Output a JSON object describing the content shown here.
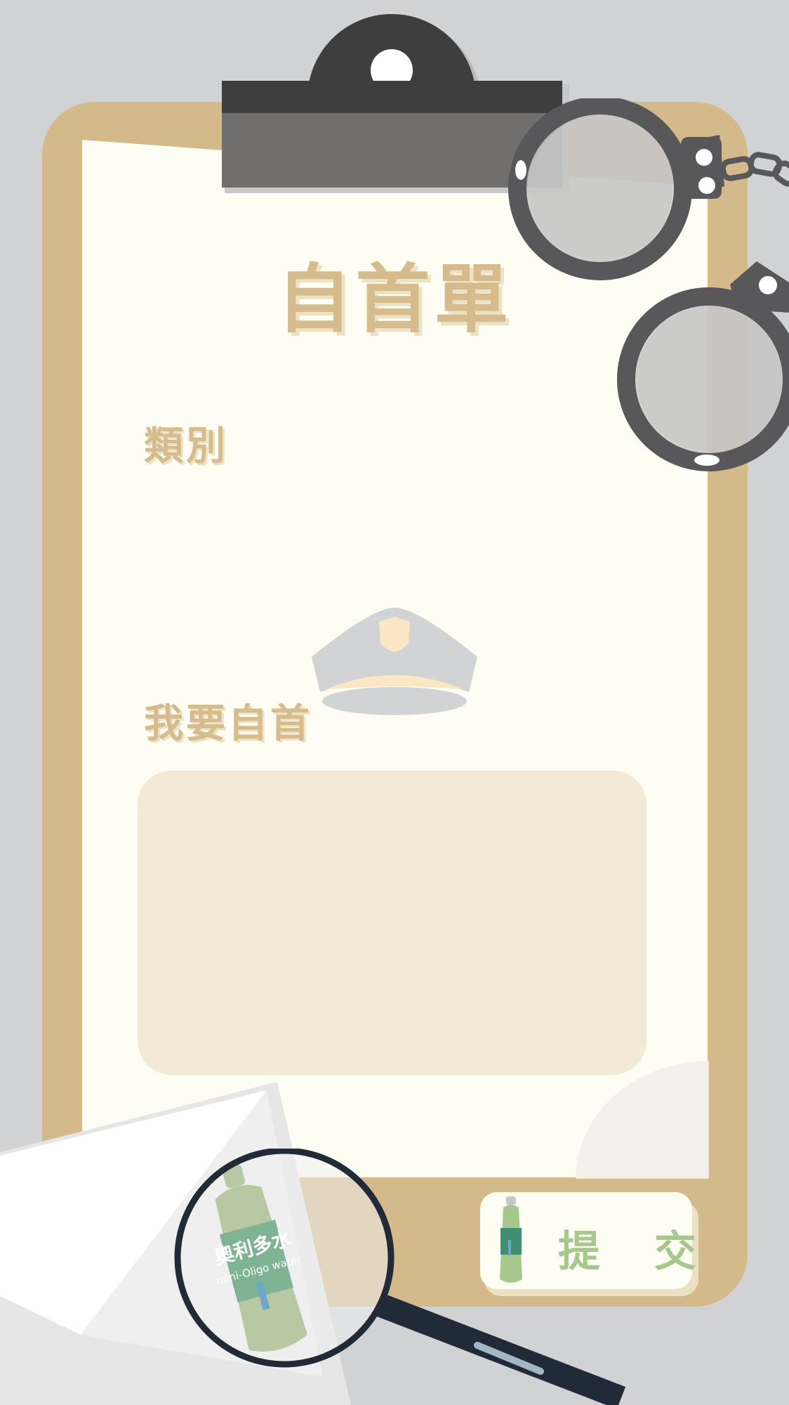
{
  "form": {
    "title": "自首單",
    "category_label": "類別",
    "confess_label": "我要自首",
    "confess_value": "",
    "submit_label": "提 交"
  },
  "product": {
    "brand_cn": "奧利多水",
    "brand_en": "mini-Oligo water"
  },
  "icons": {
    "clip": "clipboard-clip-icon",
    "handcuffs": "handcuffs-icon",
    "hat": "police-hat-icon",
    "envelope": "envelope-icon",
    "magnifier": "magnifying-glass-icon",
    "bottle": "drink-bottle-icon"
  },
  "colors": {
    "board": "#d4b98b",
    "paper": "#fefdf3",
    "accent_text": "#d6bb8c",
    "textarea_bg": "#f2ead7",
    "submit_text": "#a6c88d",
    "metal": "#58585b",
    "background": "#d1d2d4"
  }
}
